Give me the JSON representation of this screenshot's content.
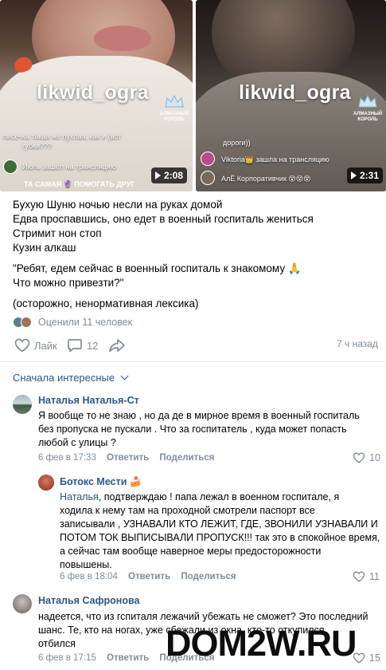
{
  "videos": [
    {
      "channel": "likwid_ogra",
      "crown_caption": "АЛМАЗНЫЙ КОРОЛЬ",
      "chat": [
        "писечка такая же пухлая, как и (вот",
        "губки???",
        "Июль зашёл на трансляцию"
      ],
      "bottom_tag": "ТА САМАЯ 🔮 ПОМОГАТЬ ДРУГ",
      "duration": "2:08"
    },
    {
      "channel": "likwid_ogra",
      "crown_caption": "АЛМАЗНЫЙ КОРОЛЬ",
      "chat": [
        "дороги))",
        "Viktoria👑 зашла на трансляцию",
        "АлЁ Корпоративчик 😵😵😵"
      ],
      "duration": "2:31"
    }
  ],
  "post": {
    "lines": [
      "Бухую Шуню ночью несли на руках домой",
      "Едва проспавшись, оно едет в военный госпиталь жениться",
      "Стримит нон стоп",
      "Кузин алкаш"
    ],
    "quote": [
      "\"Ребят, едем сейчас в военный госпиталь к знакомому 🙏",
      "Что можно привезти?\""
    ],
    "note": "(осторожно, ненормативная лексика)",
    "rated_by": "Оценили 11 человек",
    "like_label": "Лайк",
    "comments_count": "12",
    "time": "7 ч назад"
  },
  "comments_sort": "Сначала интересные",
  "comments": [
    {
      "author": "Наталья Наталья-Ст",
      "text": [
        "Я вообще то не знаю , но да де в мирное время в военный госпиталь",
        "без пропуска не пускали . Что за госпитатель , куда может попасть",
        "любой с улицы ?"
      ],
      "date": "6 фев в 17:33",
      "reply_label": "Ответить",
      "share_label": "Поделиться",
      "likes": "10"
    },
    {
      "author": "Ботокс Мести 🍰",
      "address": "Наталья",
      "text": [
        ", подтверждаю ! папа лежал в военном госпитале, я",
        "ходила к нему там на проходной смотрели паспорт все",
        "записывали , УЗНАВАЛИ КТО ЛЕЖИТ, ГДЕ, ЗВОНИЛИ УЗНАВАЛИ И",
        "ПОТОМ ТОК ВЫПИСЫВАЛИ ПРОПУСК!!! так это в спокойное время,",
        "а сейчас там вообще наверное меры предосторожности",
        "повышены."
      ],
      "date": "6 фев в 18:04",
      "reply_label": "Ответить",
      "share_label": "Поделиться",
      "likes": "11"
    },
    {
      "author": "Наталья Сафронова",
      "text": [
        "надеется, что из гспиталя лежачий убежать не сможет? Это последний",
        "шанс. Те, кто на ногах, уже сбежали из окна, кто-то откупился,",
        "отбился"
      ],
      "date": "6 фев в 17:15",
      "reply_label": "Ответить",
      "share_label": "Поделиться",
      "likes": "15"
    }
  ],
  "watermark": "DOM2W.RU",
  "colors": {
    "link": "#2a5885",
    "muted": "#818c99",
    "divider": "#e7e8ec",
    "heart_accent": "#e4532f"
  },
  "icons": [
    "play-icon",
    "crown-icon",
    "heart-icon",
    "comment-icon",
    "share-icon",
    "chevron-down-icon"
  ]
}
